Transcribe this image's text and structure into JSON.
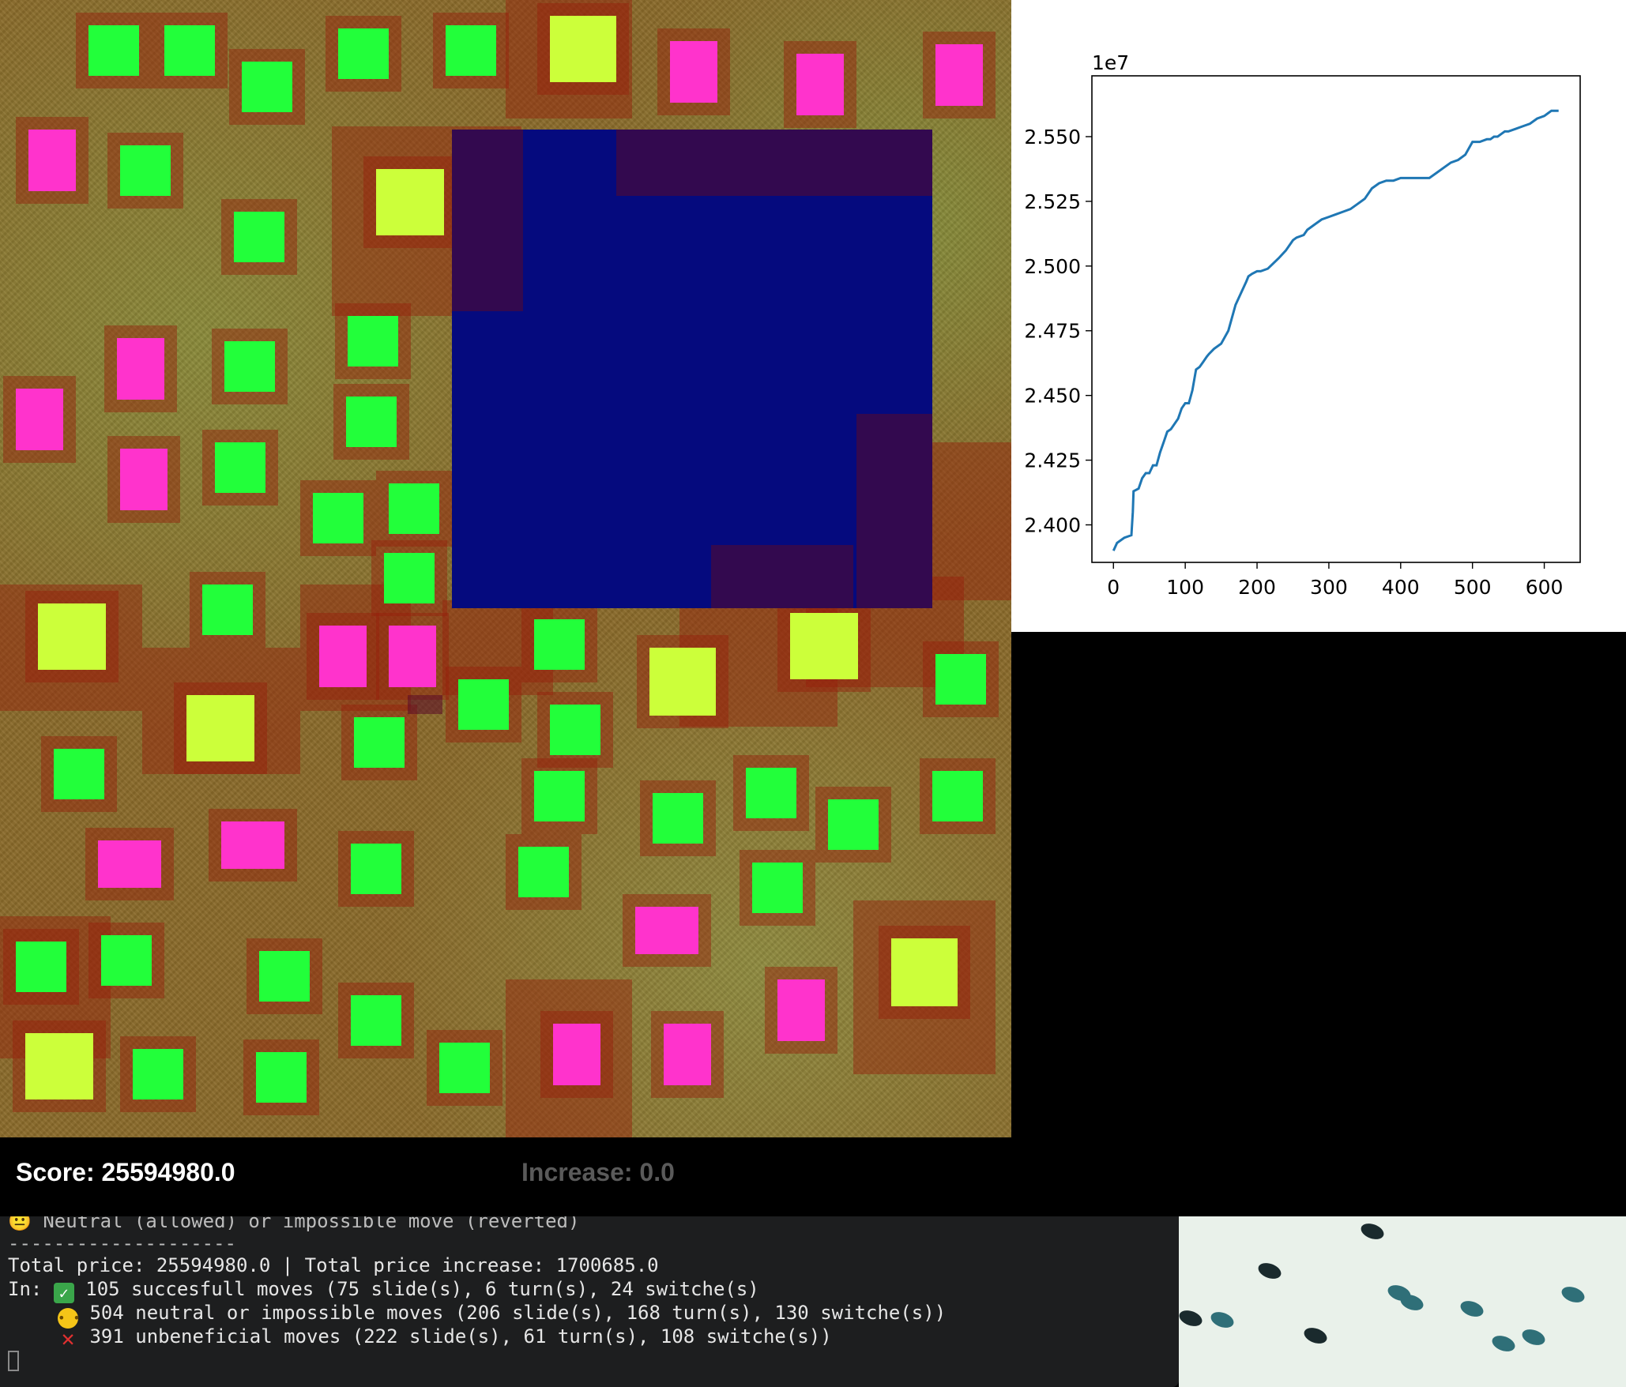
{
  "game": {
    "score_label": "Score: 25594980.0",
    "increase_label": "Increase: 0.0",
    "colors": {
      "movable_block": "#22ff3a",
      "pink_block": "#ff33cc",
      "yellow_block": "#ccff3a",
      "blue_area": "#050a7e"
    }
  },
  "chart_data": {
    "type": "line",
    "title": "",
    "xlabel": "",
    "ylabel": "",
    "offset_label": "1e7",
    "xlim": [
      -30,
      650
    ],
    "ylim": [
      2.3855,
      2.5735
    ],
    "xticks": [
      0,
      100,
      200,
      300,
      400,
      500,
      600
    ],
    "xtick_labels": [
      "0",
      "100",
      "200",
      "300",
      "400",
      "500",
      "600"
    ],
    "yticks": [
      2.4,
      2.425,
      2.45,
      2.475,
      2.5,
      2.525,
      2.55
    ],
    "ytick_labels": [
      "2.400",
      "2.425",
      "2.450",
      "2.475",
      "2.500",
      "2.525",
      "2.550"
    ],
    "series": [
      {
        "color": "#1f77b4",
        "x": [
          0,
          5,
          15,
          25,
          27,
          28,
          35,
          40,
          45,
          50,
          55,
          60,
          65,
          70,
          75,
          80,
          90,
          95,
          100,
          105,
          110,
          115,
          120,
          125,
          130,
          133,
          140,
          150,
          160,
          170,
          180,
          185,
          188,
          193,
          200,
          205,
          215,
          230,
          240,
          250,
          255,
          265,
          270,
          280,
          290,
          300,
          310,
          320,
          330,
          340,
          350,
          360,
          370,
          380,
          390,
          400,
          410,
          415,
          420,
          430,
          440,
          450,
          460,
          470,
          480,
          490,
          500,
          510,
          520,
          525,
          530,
          535,
          540,
          545,
          550,
          560,
          570,
          580,
          590,
          600,
          605,
          610,
          615,
          620
        ],
        "y": [
          2.39,
          2.393,
          2.395,
          2.396,
          2.405,
          2.413,
          2.414,
          2.418,
          2.42,
          2.42,
          2.423,
          2.423,
          2.428,
          2.432,
          2.436,
          2.437,
          2.441,
          2.445,
          2.447,
          2.447,
          2.452,
          2.46,
          2.461,
          2.463,
          2.465,
          2.466,
          2.468,
          2.47,
          2.475,
          2.485,
          2.491,
          2.494,
          2.496,
          2.497,
          2.498,
          2.498,
          2.499,
          2.503,
          2.506,
          2.51,
          2.511,
          2.512,
          2.514,
          2.516,
          2.518,
          2.519,
          2.52,
          2.521,
          2.522,
          2.524,
          2.526,
          2.53,
          2.532,
          2.533,
          2.533,
          2.534,
          2.534,
          2.534,
          2.534,
          2.534,
          2.534,
          2.536,
          2.538,
          2.54,
          2.541,
          2.543,
          2.548,
          2.548,
          2.549,
          2.549,
          2.55,
          2.55,
          2.551,
          2.552,
          2.552,
          2.553,
          2.554,
          2.555,
          2.557,
          2.558,
          2.559,
          2.56,
          2.56,
          2.56
        ]
      }
    ]
  },
  "terminal": {
    "line0": "😐 Neutral (allowed) or impossible move (reverted)",
    "line1": "--------------------",
    "line2": "Total price: 25594980.0 | Total price increase: 1700685.0",
    "line3_prefix": "In: ",
    "line3": " 105 succesfull moves (75 slide(s), 6 turn(s), 24 switche(s)",
    "line4": " 504 neutral or impossible moves (206 slide(s), 168 turn(s), 130 switche(s))",
    "line5": " 391 unbeneficial moves (222 slide(s), 61 turn(s), 108 switche(s))",
    "icons": [
      "check-mark-icon",
      "neutral-face-icon",
      "cross-mark-icon"
    ]
  }
}
